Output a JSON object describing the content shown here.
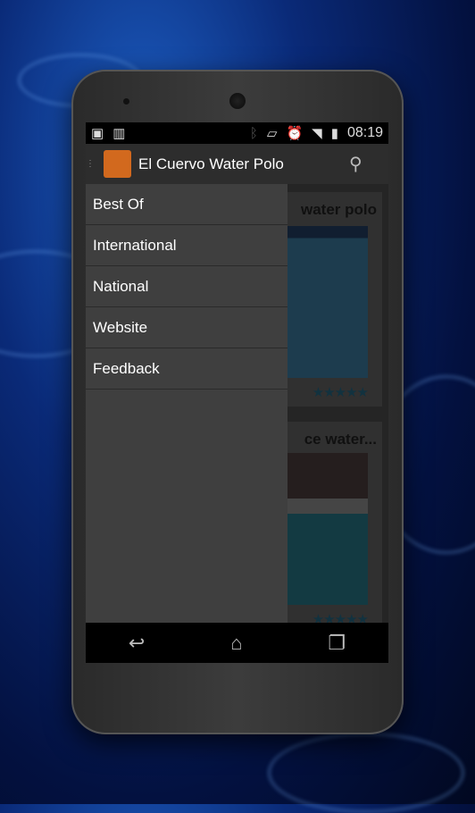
{
  "status_bar": {
    "time": "08:19",
    "icons": [
      "image-icon",
      "barcode-icon",
      "bluetooth-icon",
      "rotate-icon",
      "alarm-icon",
      "wifi-icon",
      "signal-icon",
      "battery-charging-icon"
    ]
  },
  "action_bar": {
    "title": "El Cuervo Water Polo",
    "search_icon": "search-icon"
  },
  "drawer": {
    "items": [
      {
        "label": "Best Of"
      },
      {
        "label": "International"
      },
      {
        "label": "National"
      },
      {
        "label": "Website"
      },
      {
        "label": "Feedback"
      }
    ]
  },
  "cards": [
    {
      "title": "water polo",
      "rating": 5
    },
    {
      "title": "ce water...",
      "rating": 5
    }
  ],
  "nav_bar": {
    "icons": [
      "back-icon",
      "home-icon",
      "recents-icon"
    ]
  },
  "colors": {
    "action_bar": "#2d2d2d",
    "drawer": "#3f3f3f",
    "logo": "#d2691e"
  }
}
